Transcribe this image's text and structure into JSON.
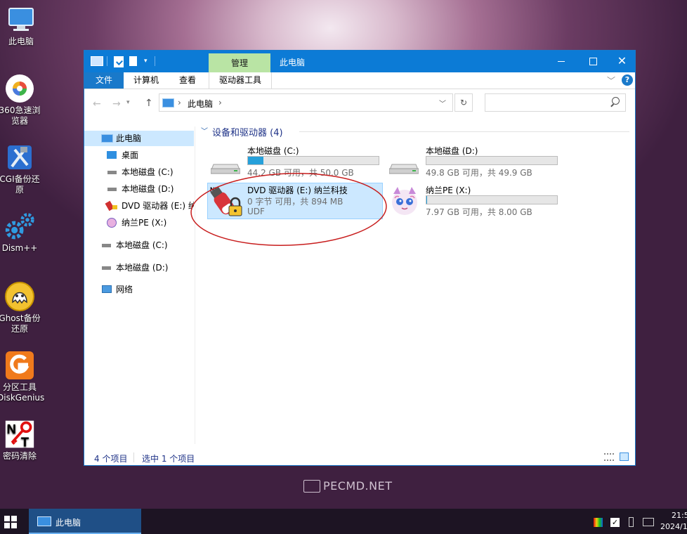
{
  "desktop": {
    "icons": [
      {
        "label": "此电脑"
      },
      {
        "label": "360急速浏览器"
      },
      {
        "label": "CGI备份还原"
      },
      {
        "label": "Dism++"
      },
      {
        "label": "Ghost备份还原"
      },
      {
        "label": "分区工具DiskGenius"
      },
      {
        "label": "密码清除"
      }
    ],
    "watermark": "PECMD.NET"
  },
  "window": {
    "context_tab": "管理",
    "title": "此电脑",
    "ribbon_tabs": [
      "文件",
      "计算机",
      "查看",
      "驱动器工具"
    ],
    "address": {
      "path": "此电脑"
    },
    "search": {
      "placeholder": ""
    },
    "nav_pane": [
      "此电脑",
      "桌面",
      "本地磁盘 (C:)",
      "本地磁盘 (D:)",
      "DVD 驱动器 (E:) 纳",
      "纳兰PE (X:)",
      "本地磁盘 (C:)",
      "本地磁盘 (D:)",
      "网络"
    ],
    "group_header": "设备和驱动器 (4)",
    "drives": [
      {
        "name": "本地磁盘 (C:)",
        "info": "44.2 GB 可用，共 50.0 GB",
        "usage": 0.12
      },
      {
        "name": "本地磁盘 (D:)",
        "info": "49.8 GB 可用，共 49.9 GB",
        "usage": 0.0
      },
      {
        "name": "DVD 驱动器 (E:) 纳兰科技",
        "info": "0 字节 可用，共 894 MB",
        "fs": "UDF"
      },
      {
        "name": "纳兰PE (X:)",
        "info": "7.97 GB 可用，共 8.00 GB",
        "usage": 0.004
      }
    ],
    "status": {
      "count": "4 个项目",
      "selected": "选中 1 个项目"
    }
  },
  "taskbar": {
    "active_app": "此电脑",
    "clock_time": "21:5",
    "clock_date": "2024/1"
  },
  "colors": {
    "accent": "#0c7bd6",
    "context_tab": "#b9e4a4",
    "selection": "#cce8ff",
    "annotation": "#c81e1e"
  }
}
